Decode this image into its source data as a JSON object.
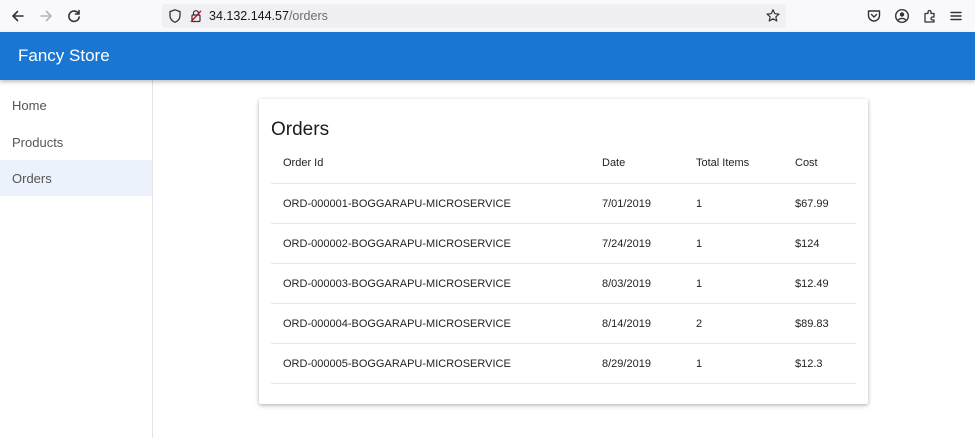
{
  "browser": {
    "url_host": "34.132.144.57",
    "url_path": "/orders",
    "icons": [
      "back-icon",
      "forward-icon",
      "reload-icon",
      "shield-icon",
      "lock-icon",
      "star-icon",
      "pocket-icon",
      "account-icon",
      "extensions-icon",
      "menu-icon"
    ]
  },
  "app": {
    "title": "Fancy Store",
    "accent_color": "#1976d2"
  },
  "sidebar": {
    "items": [
      {
        "label": "Home",
        "active": false
      },
      {
        "label": "Products",
        "active": false
      },
      {
        "label": "Orders",
        "active": true
      }
    ]
  },
  "orders": {
    "heading": "Orders",
    "columns": [
      "Order Id",
      "Date",
      "Total Items",
      "Cost"
    ],
    "rows": [
      [
        "ORD-000001-BOGGARAPU-MICROSERVICE",
        "7/01/2019",
        "1",
        "$67.99"
      ],
      [
        "ORD-000002-BOGGARAPU-MICROSERVICE",
        "7/24/2019",
        "1",
        "$124"
      ],
      [
        "ORD-000003-BOGGARAPU-MICROSERVICE",
        "8/03/2019",
        "1",
        "$12.49"
      ],
      [
        "ORD-000004-BOGGARAPU-MICROSERVICE",
        "8/14/2019",
        "2",
        "$89.83"
      ],
      [
        "ORD-000005-BOGGARAPU-MICROSERVICE",
        "8/29/2019",
        "1",
        "$12.3"
      ]
    ]
  }
}
